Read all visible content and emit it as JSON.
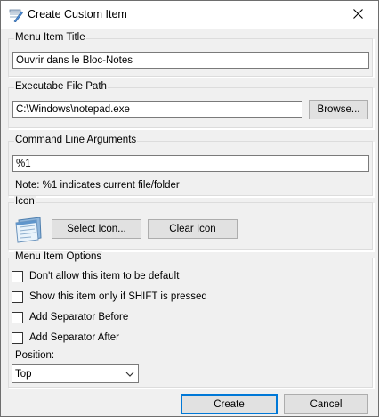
{
  "window": {
    "title": "Create Custom Item",
    "close_glyph": "✕"
  },
  "menu_item_title": {
    "legend": "Menu Item Title",
    "value": "Ouvrir dans le Bloc-Notes"
  },
  "executable": {
    "legend": "Executabe File Path",
    "value": "C:\\Windows\\notepad.exe",
    "browse_label": "Browse..."
  },
  "arguments": {
    "legend": "Command Line Arguments",
    "value": "%1",
    "note": "Note: %1 indicates current file/folder"
  },
  "icon": {
    "legend": "Icon",
    "select_label": "Select Icon...",
    "clear_label": "Clear Icon",
    "preview": "notepad-icon"
  },
  "options": {
    "legend": "Menu Item Options",
    "items": [
      {
        "label": "Don't allow this item to be default",
        "checked": false
      },
      {
        "label": "Show this item only if SHIFT is pressed",
        "checked": false
      },
      {
        "label": "Add Separator Before",
        "checked": false
      },
      {
        "label": "Add Separator After",
        "checked": false
      }
    ],
    "position_label": "Position:",
    "position_value": "Top"
  },
  "footer": {
    "create_label": "Create",
    "cancel_label": "Cancel"
  },
  "colors": {
    "accent": "#0078d7",
    "background": "#f0f0f0"
  }
}
